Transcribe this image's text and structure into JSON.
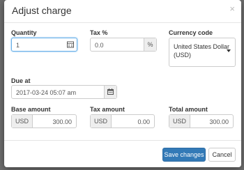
{
  "modal": {
    "title": "Adjust charge",
    "close_glyph": "×"
  },
  "quantity": {
    "label": "Quantity",
    "value": "1",
    "icon": "calculator-icon"
  },
  "tax": {
    "label": "Tax %",
    "value": "0.0",
    "suffix": "%"
  },
  "currency": {
    "label": "Currency code",
    "selected_line1": "United States Dollar",
    "selected_line2": "(USD)"
  },
  "due": {
    "label": "Due at",
    "value": "2017-03-24 05:07 am",
    "icon": "calendar-icon"
  },
  "base_amount": {
    "label": "Base amount",
    "prefix": "USD",
    "value": "300.00"
  },
  "tax_amount": {
    "label": "Tax amount",
    "prefix": "USD",
    "value": "0.00"
  },
  "total_amount": {
    "label": "Total amount",
    "prefix": "USD",
    "value": "300.00"
  },
  "footer": {
    "save_label": "Save changes",
    "cancel_label": "Cancel"
  },
  "colors": {
    "primary": "#337ab7",
    "focus": "#66afe9",
    "backdrop": "#6e6e6e"
  }
}
